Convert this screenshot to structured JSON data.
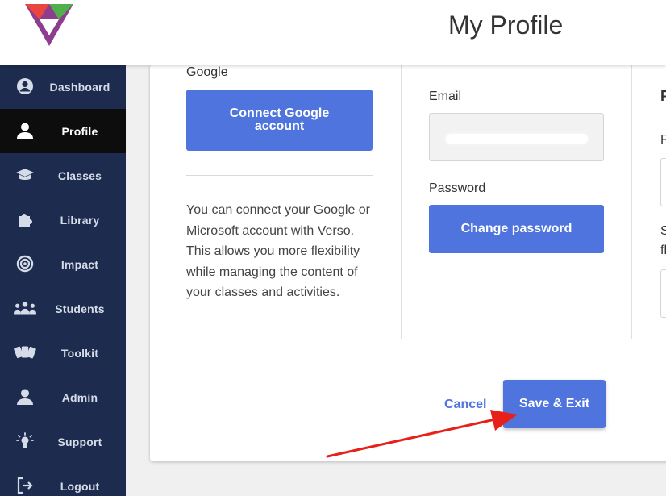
{
  "header": {
    "title": "My Profile"
  },
  "sidebar": {
    "items": [
      {
        "label": "Dashboard",
        "icon": "user-circle-icon",
        "active": false
      },
      {
        "label": "Profile",
        "icon": "user-icon",
        "active": true
      },
      {
        "label": "Classes",
        "icon": "graduation-cap-icon",
        "active": false
      },
      {
        "label": "Library",
        "icon": "puzzle-icon",
        "active": false
      },
      {
        "label": "Impact",
        "icon": "target-icon",
        "active": false
      },
      {
        "label": "Students",
        "icon": "users-icon",
        "active": false
      },
      {
        "label": "Toolkit",
        "icon": "cards-icon",
        "active": false
      },
      {
        "label": "Admin",
        "icon": "user-icon",
        "active": false
      },
      {
        "label": "Support",
        "icon": "lightbulb-icon",
        "active": false
      },
      {
        "label": "Logout",
        "icon": "logout-icon",
        "active": false
      }
    ]
  },
  "profile": {
    "google_label": "Google",
    "connect_google_label": "Connect Google account",
    "description": "You can connect your Google or Microsoft account with Verso. This allows you more flexibility while managing the content of your classes and activities.",
    "email_label": "Email",
    "email_value": "",
    "password_label": "Password",
    "change_password_label": "Change password",
    "right_col_heading": "P",
    "right_col_label_1": "P",
    "right_col_label_2a": "S",
    "right_col_label_2b": "fl"
  },
  "actions": {
    "cancel_label": "Cancel",
    "save_label": "Save & Exit"
  },
  "colors": {
    "sidebar_bg": "#1d2b4f",
    "accent": "#4f74de",
    "active_bg": "#0d0d0d",
    "arrow": "#e8201a"
  }
}
